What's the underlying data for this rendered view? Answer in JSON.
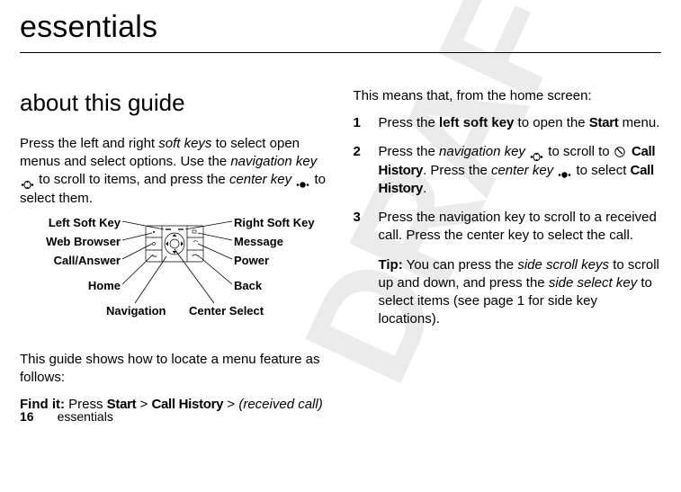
{
  "title": "essentials",
  "watermark": "DRAFT",
  "left": {
    "heading": "about this guide",
    "intro_parts": {
      "a": "Press the left and right ",
      "b": "soft keys",
      "c": " to select open menus and select options. Use the ",
      "d": "navigation key",
      "e": " to scroll to items, and press the ",
      "f": "center key",
      "g": " to select them."
    },
    "diagram": {
      "left_soft_key": "Left Soft Key",
      "web_browser": "Web Browser",
      "call_answer": "Call/Answer",
      "home": "Home",
      "navigation": "Navigation",
      "center_select": "Center Select",
      "right_soft_key": "Right Soft Key",
      "message": "Message",
      "power": "Power",
      "back": "Back"
    },
    "follow": "This guide shows how to locate a menu feature as follows:",
    "findit": {
      "label": "Find it:",
      "a": " Press ",
      "start": "Start",
      "sep": " > ",
      "ch": "Call History",
      "received": "(received call)"
    }
  },
  "right": {
    "lead": "This means that, from the home screen:",
    "items": [
      {
        "n": "1",
        "a": "Press the ",
        "b": "left soft key",
        "c": " to open the ",
        "d": "Start",
        "e": " menu."
      },
      {
        "n": "2",
        "a": "Press the ",
        "b": "navigation key",
        "c": " to scroll to ",
        "d": "Call History",
        "e": ". Press the ",
        "f": "center key",
        "g": " to select ",
        "h": "Call History",
        "i": "."
      },
      {
        "n": "3",
        "a": "Press the navigation key to scroll to a received call. Press the center key to select the call."
      }
    ],
    "tip": {
      "label": "Tip:",
      "a": " You can press the ",
      "b": "side scroll keys",
      "c": " to scroll up and down, and press the ",
      "d": "side select key",
      "e": " to select items (see page 1 for side key locations)."
    }
  },
  "footer": {
    "page": "16",
    "section": "essentials"
  }
}
